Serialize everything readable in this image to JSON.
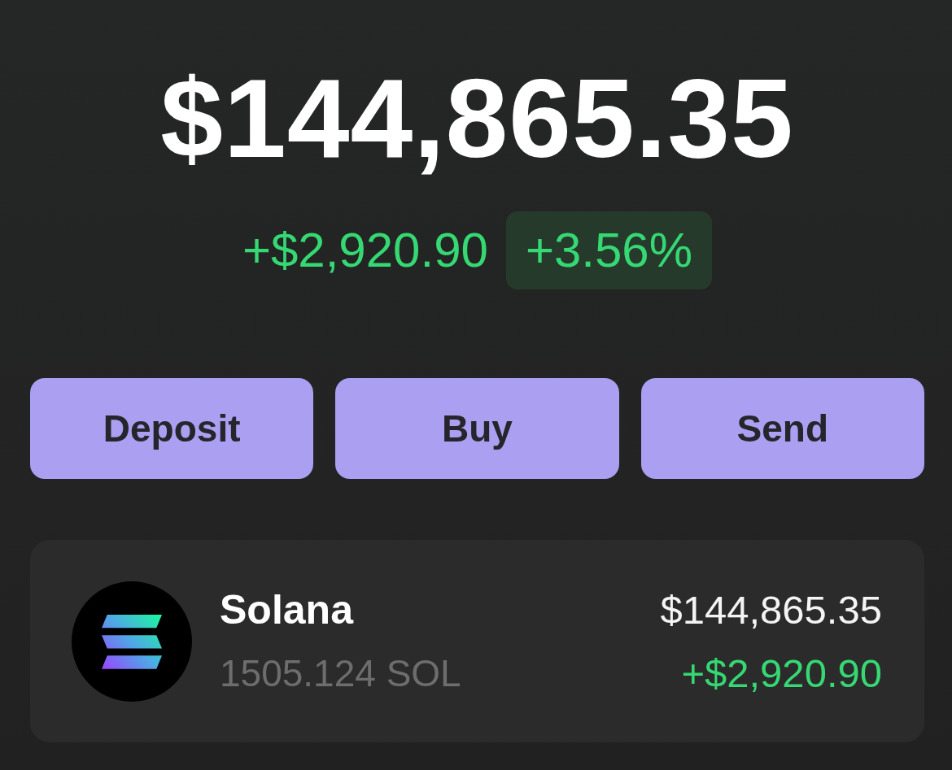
{
  "balance": {
    "total": "$144,865.35",
    "change_amount": "+$2,920.90",
    "change_percent": "+3.56%"
  },
  "actions": [
    {
      "label": "Deposit"
    },
    {
      "label": "Buy"
    },
    {
      "label": "Send"
    }
  ],
  "tokens": [
    {
      "name": "Solana",
      "amount": "1505.124 SOL",
      "value": "$144,865.35",
      "change": "+$2,920.90"
    }
  ]
}
